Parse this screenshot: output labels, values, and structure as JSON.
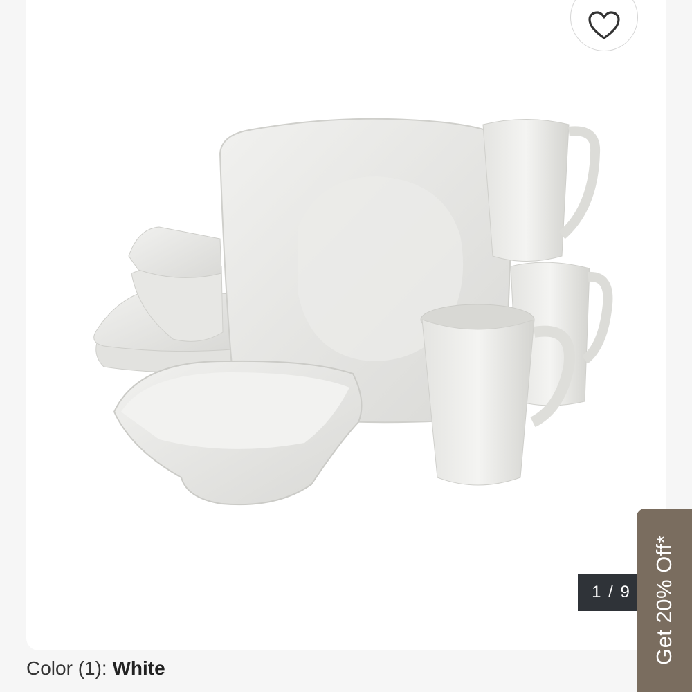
{
  "gallery": {
    "counter": "1 / 9",
    "wishlist_icon": "heart-icon",
    "image_subject": "dinnerware-set"
  },
  "promo": {
    "label": "Get 20% Off*"
  },
  "color": {
    "label": "Color (1): ",
    "value": "White"
  },
  "colors": {
    "page_bg": "#f6f6f6",
    "counter_bg": "#2f3338",
    "promo_bg": "#7a6d5f",
    "dish_white": "#ececea"
  }
}
